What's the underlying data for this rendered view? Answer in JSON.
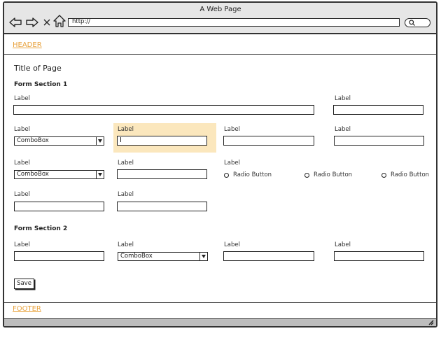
{
  "window": {
    "title": "A Web Page"
  },
  "browser": {
    "url": "http://",
    "nav_icons": [
      "back-arrow-icon",
      "forward-arrow-icon",
      "close-x-icon",
      "home-icon",
      "search-icon"
    ]
  },
  "header": {
    "link": "HEADER"
  },
  "page": {
    "title": "Title of Page"
  },
  "section1": {
    "title": "Form Section 1",
    "row1": {
      "wide_label": "Label",
      "wide_value": "",
      "right_label": "Label",
      "right_value": ""
    },
    "row2": {
      "combo_label": "Label",
      "combo_value": "ComboBox",
      "focused_label": "Label",
      "focused_value": "",
      "field3_label": "Label",
      "field3_value": "",
      "field4_label": "Label",
      "field4_value": ""
    },
    "row3": {
      "combo_label": "Label",
      "combo_value": "ComboBox",
      "field2_label": "Label",
      "field2_value": "",
      "radio_group_label": "Label",
      "radios": [
        "Radio Button",
        "Radio Button",
        "Radio Button"
      ]
    },
    "row4": {
      "field1_label": "Label",
      "field1_value": "",
      "field2_label": "Label",
      "field2_value": ""
    }
  },
  "section2": {
    "title": "Form Section 2",
    "field1_label": "Label",
    "field1_value": "",
    "combo_label": "Label",
    "combo_value": "ComboBox",
    "field3_label": "Label",
    "field3_value": "",
    "field4_label": "Label",
    "field4_value": ""
  },
  "actions": {
    "save_label": "Save"
  },
  "footer": {
    "link": "FOOTER"
  },
  "colors": {
    "link": "#e8a23c",
    "focus_highlight": "#fbe7bd",
    "chrome": "#e6e6e6",
    "statusbar": "#bdbdbd"
  }
}
